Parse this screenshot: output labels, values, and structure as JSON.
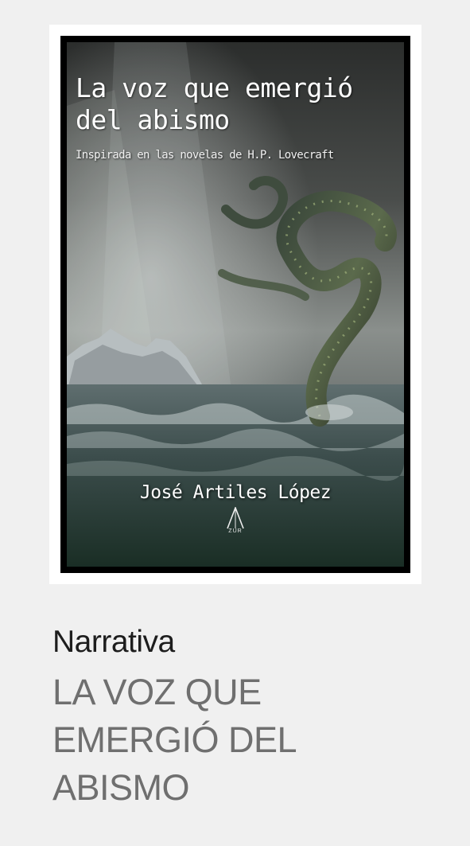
{
  "product": {
    "category": "Narrativa",
    "title": "LA VOZ QUE EMERGIÓ DEL ABISMO"
  },
  "cover": {
    "title": "La voz que emergió del abismo",
    "subtitle": "Inspirada en las novelas de H.P. Lovecraft",
    "author": "José Artiles López",
    "publisher": "ZUR"
  },
  "colors": {
    "page_background": "#f0f0f0",
    "category_text": "#1d1d1d",
    "title_text": "#6f6f6f"
  }
}
